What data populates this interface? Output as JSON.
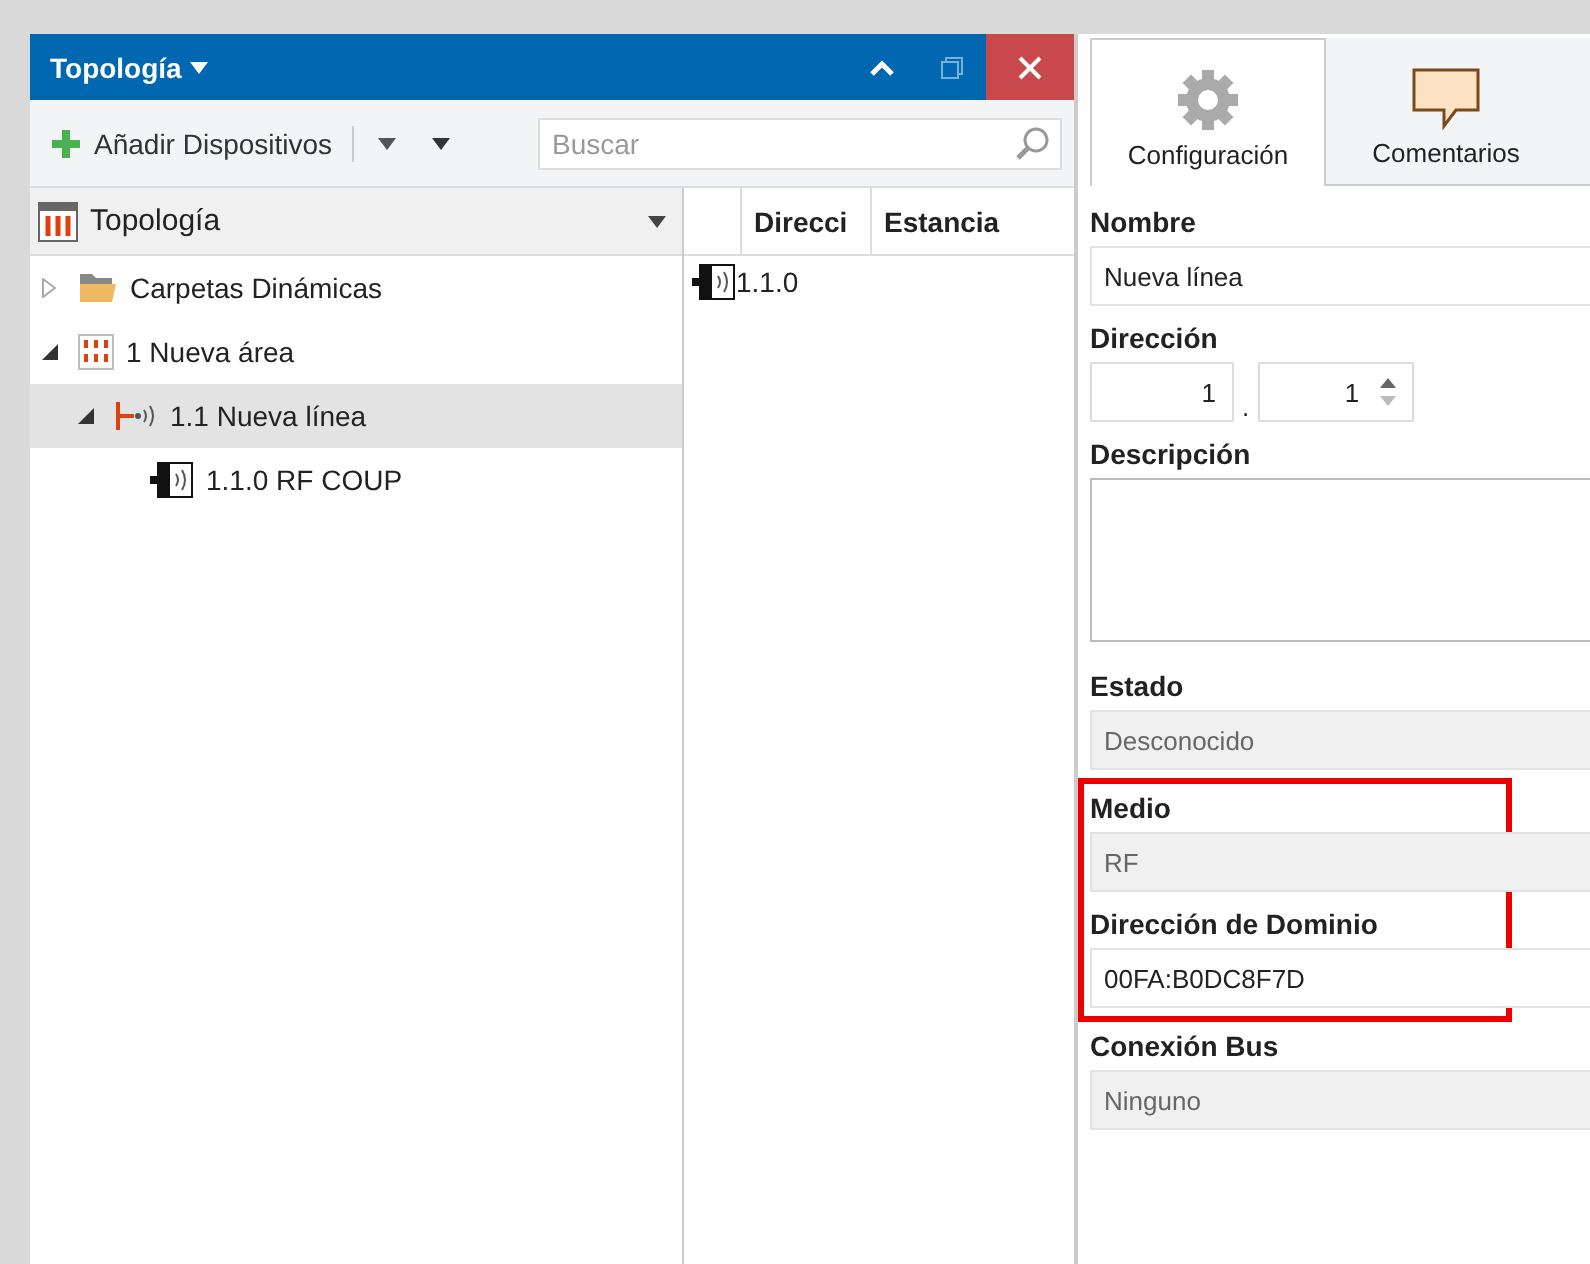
{
  "panel": {
    "title": "Topología"
  },
  "toolbar": {
    "add_label": "Añadir Dispositivos",
    "search": {
      "placeholder": "Buscar"
    }
  },
  "tree": {
    "header": "Topología",
    "nodes": [
      {
        "label": "Carpetas Dinámicas",
        "kind": "folder",
        "expanded": false,
        "selected": false
      },
      {
        "label": "1 Nueva área",
        "kind": "area",
        "expanded": true,
        "selected": false,
        "children": [
          {
            "label": "1.1 Nueva línea",
            "kind": "line",
            "expanded": true,
            "selected": true,
            "children": [
              {
                "label": "1.1.0 RF COUP",
                "kind": "device",
                "expanded": false,
                "selected": false
              }
            ]
          }
        ]
      }
    ]
  },
  "list": {
    "columns": [
      "Direcci",
      "Estancia"
    ],
    "rows": [
      {
        "address": "1.1.0"
      }
    ]
  },
  "tabs": [
    {
      "label": "Configuración",
      "kind": "gear",
      "selected": true
    },
    {
      "label": "Comentarios",
      "kind": "comment",
      "selected": false
    }
  ],
  "fields": [
    {
      "label": "Nombre",
      "kind": "text",
      "value": "Nueva línea",
      "highlighted": false
    },
    {
      "label": "Dirección",
      "kind": "address",
      "parts": [
        "1",
        "1"
      ],
      "separator": ".",
      "highlighted": false
    },
    {
      "label": "Descripción",
      "kind": "textarea",
      "highlighted": false
    },
    {
      "label": "Estado",
      "kind": "readonly",
      "value": "Desconocido",
      "highlighted": false
    },
    {
      "label": "Medio",
      "kind": "readonly",
      "value": "RF",
      "highlighted": true
    },
    {
      "label": "Dirección de Dominio",
      "kind": "text",
      "value": "00FA:B0DC8F7D",
      "highlighted": true
    },
    {
      "label": "Conexión Bus",
      "kind": "readonly",
      "value": "Ninguno",
      "highlighted": false
    }
  ]
}
